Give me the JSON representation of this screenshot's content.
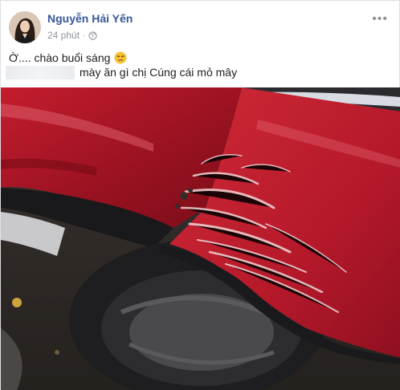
{
  "post": {
    "author_name": "Nguyễn Hải Yến",
    "timestamp": "24 phút",
    "separator": "·",
    "privacy_icon": "globe-icon",
    "more_icon": "more-options-icon",
    "more_label": "•••",
    "line1_text": "Ờ.... chào buổi sáng",
    "line1_emoji": "unamused-face-emoji",
    "line2_text": "mày ăn gì chị Cúng cái mỏ mây",
    "photo_subject": "scratched-red-car-fender"
  },
  "colors": {
    "author": "#385898",
    "meta": "#90949c",
    "car_red": "#b8182a",
    "tire": "#1e1e20"
  }
}
